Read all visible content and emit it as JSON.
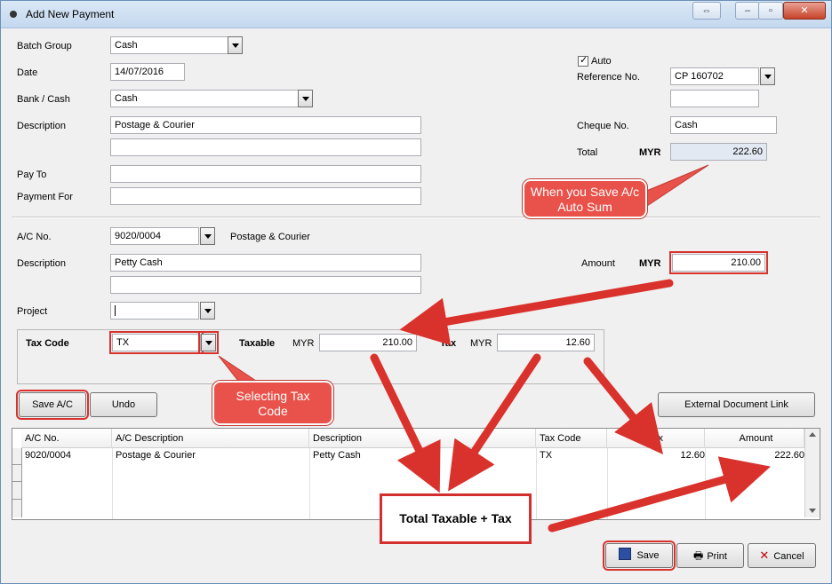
{
  "window": {
    "title": "Add New Payment"
  },
  "header": {
    "batch_group_label": "Batch Group",
    "batch_group_value": "Cash",
    "date_label": "Date",
    "date_value": "14/07/2016",
    "bank_label": "Bank / Cash",
    "bank_value": "Cash",
    "description_label": "Description",
    "description_value": "Postage & Courier",
    "description_value2": "",
    "pay_to_label": "Pay To",
    "pay_to_value": "",
    "payment_for_label": "Payment For",
    "payment_for_value": "",
    "auto_label": "Auto",
    "auto_checked": true,
    "reference_label": "Reference No.",
    "reference_value": "CP 160702",
    "reference_value2": "",
    "cheque_label": "Cheque No.",
    "cheque_value": "Cash",
    "total_label": "Total",
    "total_currency": "MYR",
    "total_value": "222.60"
  },
  "detail": {
    "ac_no_label": "A/C No.",
    "ac_no_value": "9020/0004",
    "ac_name": "Postage & Courier",
    "description_label": "Description",
    "description_value": "Petty Cash",
    "description_value2": "",
    "amount_label": "Amount",
    "amount_currency": "MYR",
    "amount_value": "210.00",
    "project_label": "Project",
    "project_value": "",
    "tax_code_label": "Tax Code",
    "tax_code_value": "TX",
    "taxable_label": "Taxable",
    "taxable_currency": "MYR",
    "taxable_value": "210.00",
    "tax_label": "Tax",
    "tax_currency": "MYR",
    "tax_value": "12.60"
  },
  "buttons": {
    "save_ac": "Save A/C",
    "undo": "Undo",
    "external_link": "External Document Link",
    "save": "Save",
    "print": "Print",
    "cancel": "Cancel"
  },
  "grid": {
    "columns": [
      "A/C No.",
      "A/C Description",
      "Description",
      "Tax Code",
      "Tax",
      "Amount"
    ],
    "rows": [
      {
        "ac_no": "9020/0004",
        "ac_desc": "Postage & Courier",
        "desc": "Petty Cash",
        "tax_code": "TX",
        "tax": "12.60",
        "amount": "222.60"
      }
    ]
  },
  "annotations": {
    "callout_auto_sum": "When you Save A/c Auto Sum",
    "callout_tax_code": "Selecting Tax Code",
    "note_total": "Total Taxable + Tax",
    "accent_color": "#e8524a",
    "outline_color": "#d9322c"
  }
}
